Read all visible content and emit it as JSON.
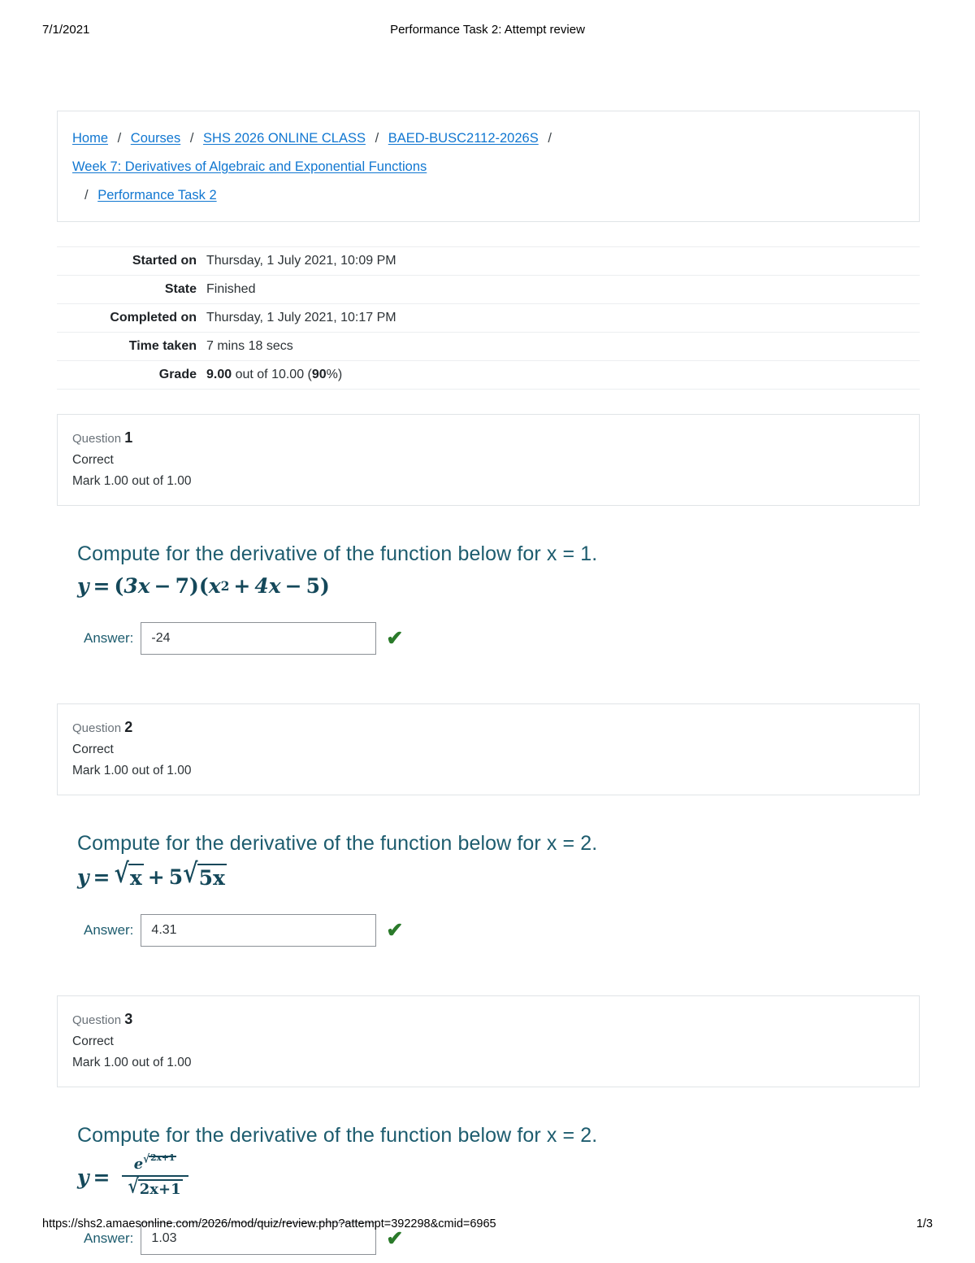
{
  "print_header": {
    "date": "7/1/2021",
    "title": "Performance Task 2: Attempt review"
  },
  "breadcrumb": {
    "items": [
      "Home",
      "Courses",
      "SHS 2026 ONLINE CLASS",
      "BAED-BUSC2112-2026S",
      "Week 7: Derivatives of Algebraic and Exponential Functions",
      "Performance Task 2"
    ],
    "separator": "/"
  },
  "summary": {
    "rows": [
      {
        "label": "Started on",
        "value": "Thursday, 1 July 2021, 10:09 PM"
      },
      {
        "label": "State",
        "value": "Finished"
      },
      {
        "label": "Completed on",
        "value": "Thursday, 1 July 2021, 10:17 PM"
      },
      {
        "label": "Time taken",
        "value": "7 mins 18 secs"
      }
    ],
    "grade": {
      "label": "Grade",
      "score": "9.00",
      "middle": " out of 10.00 (",
      "percent": "90",
      "suffix": "%)"
    }
  },
  "questions": [
    {
      "number_label": "Question",
      "number": "1",
      "state": "Correct",
      "mark": "Mark 1.00 out of 1.00",
      "prompt": "Compute for the derivative of the function below for x = 1.",
      "formula_text": "y = (3x − 7)(x² + 4x − 5)",
      "formula_parts": {
        "lhs": "y",
        "eq": "=",
        "p1_open": "(",
        "p1_a": "3x",
        "p1_minus": "−",
        "p1_b": "7",
        "p1_close": ")",
        "p2_open": "(",
        "p2_x": "x",
        "p2_exp": "2",
        "p2_plus": "+",
        "p2_b": "4x",
        "p2_minus": "−",
        "p2_c": "5",
        "p2_close": ")"
      },
      "answer_label": "Answer:",
      "answer_value": "-24",
      "feedback_icon": "check-icon",
      "feedback_glyph": "✔"
    },
    {
      "number_label": "Question",
      "number": "2",
      "state": "Correct",
      "mark": "Mark 1.00 out of 1.00",
      "prompt": "Compute for the derivative of the function below for x = 2.",
      "formula_text": "y = √x + 5√(5x)",
      "formula_parts": {
        "lhs": "y",
        "eq": "=",
        "radical": "√",
        "r1_body": "x",
        "plus": "+",
        "coef": "5",
        "r2_body": "5x"
      },
      "answer_label": "Answer:",
      "answer_value": "4.31",
      "feedback_icon": "check-icon",
      "feedback_glyph": "✔"
    },
    {
      "number_label": "Question",
      "number": "3",
      "state": "Correct",
      "mark": "Mark 1.00 out of 1.00",
      "prompt": "Compute for the derivative of the function below for x = 2.",
      "formula_text": "y = e^√(2x+1) / √(2x+1)",
      "formula_parts": {
        "lhs": "y",
        "eq": "=",
        "radical": "√",
        "num_base": "e",
        "num_exp_body": "2x+1",
        "den_body": "2x+1"
      },
      "answer_label": "Answer:",
      "answer_value": "1.03",
      "feedback_icon": "check-icon",
      "feedback_glyph": "✔"
    }
  ],
  "print_footer": {
    "url": "https://shs2.amaesonline.com/2026/mod/quiz/review.php?attempt=392298&cmid=6965",
    "page": "1/3"
  },
  "colors": {
    "link": "#1177d1",
    "heading": "#1d5c6e",
    "formula": "#14485a",
    "correct": "#2a7a2a",
    "border": "#e0e4e7"
  }
}
